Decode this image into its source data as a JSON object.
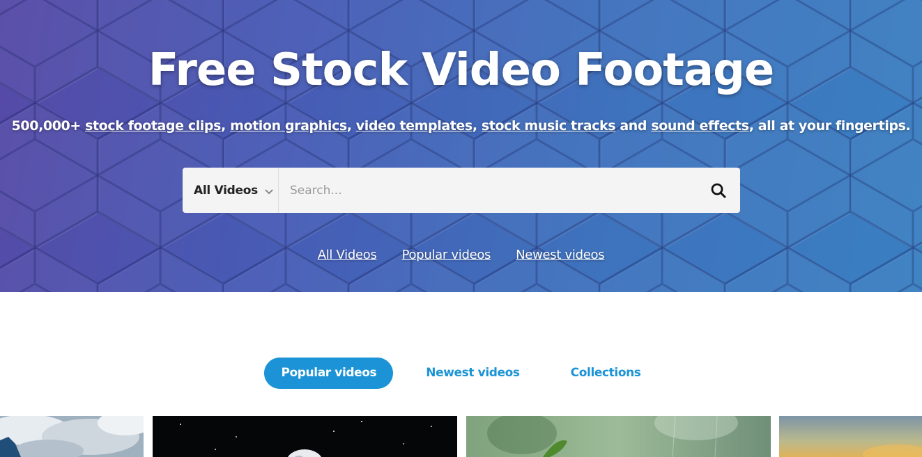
{
  "hero": {
    "title": "Free Stock Video Footage",
    "subtitle": {
      "prefix": "500,000+ ",
      "link1": "stock footage clips",
      "sep1": ", ",
      "link2": "motion graphics",
      "sep2": ", ",
      "link3": "video templates",
      "sep3": ", ",
      "link4": "stock music tracks",
      "sep4": " and ",
      "link5": "sound effects",
      "suffix": ", all at your fingertips."
    },
    "links": {
      "all": "All Videos",
      "popular": "Popular videos",
      "newest": "Newest videos"
    }
  },
  "search": {
    "category": "All Videos",
    "placeholder": "Search...",
    "value": ""
  },
  "tabs": {
    "popular": "Popular videos",
    "newest": "Newest videos",
    "collections": "Collections"
  },
  "colors": {
    "accent": "#1b93d6",
    "hero_start": "#5a4aa8",
    "hero_end": "#3b87c7"
  },
  "icons": {
    "search": "magnifier-icon",
    "dropdown": "chevron-down-icon"
  }
}
